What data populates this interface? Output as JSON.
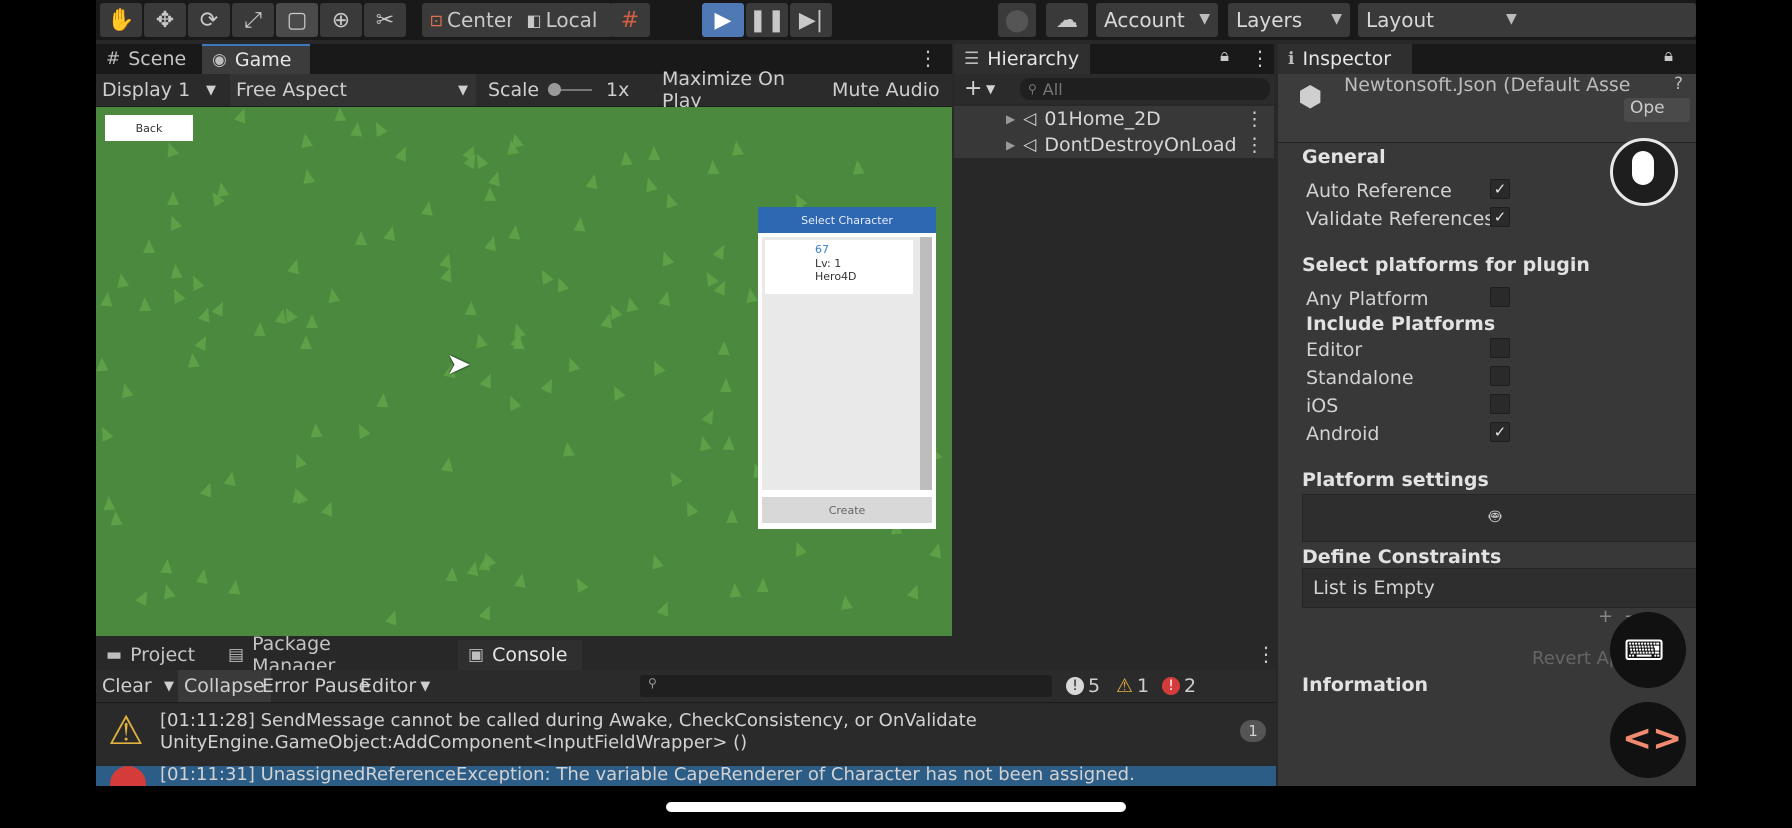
{
  "toolbar": {
    "tools": [
      {
        "icon": "hand-icon",
        "glyph": "✋"
      },
      {
        "icon": "move-icon",
        "glyph": "✥"
      },
      {
        "icon": "rotate-icon",
        "glyph": "⟳"
      },
      {
        "icon": "scale-icon",
        "glyph": "⤢"
      },
      {
        "icon": "rect-tool-icon",
        "glyph": "▢"
      },
      {
        "icon": "transform-icon",
        "glyph": "⊕"
      },
      {
        "icon": "custom-tool-icon",
        "glyph": "✂"
      }
    ],
    "pivot_mode": "Center",
    "pivot_rotation": "Local",
    "account_label": "Account",
    "layers_label": "Layers",
    "layout_label": "Layout"
  },
  "scene_tab": "Scene",
  "game_tab": "Game",
  "game_bar": {
    "display": "Display 1",
    "aspect": "Free Aspect",
    "scale_label": "Scale",
    "scale_value": "1x",
    "maximize": "Maximize On Play",
    "mute": "Mute Audio"
  },
  "game": {
    "back_button": "Back",
    "select_title": "Select Character",
    "character": {
      "id": "67",
      "level": "Lv: 1",
      "name": "Hero4D"
    },
    "create_button": "Create"
  },
  "hierarchy": {
    "tab": "Hierarchy",
    "search_placeholder": "All",
    "items": [
      "01Home_2D",
      "DontDestroyOnLoad"
    ]
  },
  "inspector": {
    "tab": "Inspector",
    "asset_title": "Newtonsoft.Json (Default Asse",
    "open_button": "Ope",
    "general_header": "General",
    "auto_reference": "Auto Reference",
    "validate_references": "Validate References",
    "select_platforms_header": "Select platforms for plugin",
    "any_platform": "Any Platform",
    "include_platforms": "Include Platforms",
    "platforms": [
      {
        "name": "Editor",
        "checked": false
      },
      {
        "name": "Standalone",
        "checked": false
      },
      {
        "name": "iOS",
        "checked": false
      },
      {
        "name": "Android",
        "checked": true
      }
    ],
    "platform_settings_header": "Platform settings",
    "define_constraints_header": "Define Constraints",
    "list_empty": "List is Empty",
    "revert_apply": "Revert Apply",
    "information_header": "Information"
  },
  "bottom_tabs": {
    "project": "Project",
    "package_manager": "Package Manager",
    "console": "Console"
  },
  "console": {
    "clear": "Clear",
    "collapse": "Collapse",
    "error_pause": "Error Pause",
    "editor": "Editor",
    "log_count": "5",
    "warn_count": "1",
    "error_count": "2",
    "entries": [
      {
        "line1": "[01:11:28] SendMessage cannot be called during Awake, CheckConsistency, or OnValidate",
        "line2": "UnityEngine.GameObject:AddComponent<InputFieldWrapper> ()",
        "count": "1"
      },
      {
        "line1": "[01:11:31] UnassignedReferenceException: The variable CapeRenderer of Character has not been assigned."
      }
    ]
  },
  "colors": {
    "accent": "#3a79bb",
    "play_active": "#4f79b5",
    "grass": "#4b8a3e",
    "warning": "#e0b040",
    "error": "#d43c3c"
  }
}
